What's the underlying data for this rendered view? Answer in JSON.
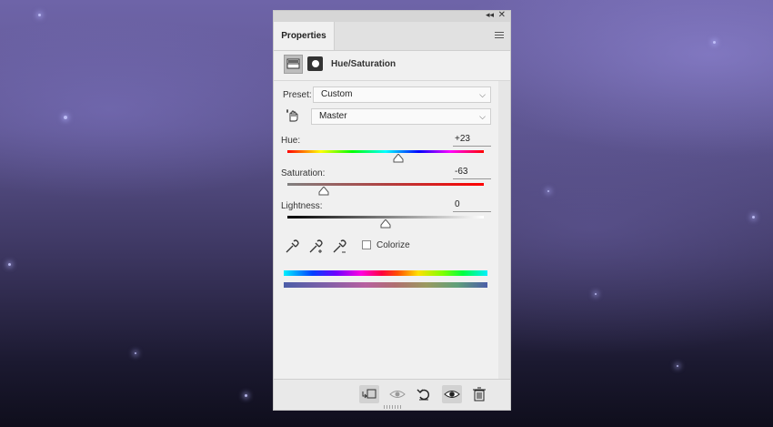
{
  "panel": {
    "tab_label": "Properties",
    "collapse_icon": "double-chevron-icon",
    "close_icon": "close-icon",
    "menu_icon": "panel-menu-icon",
    "adjustment_title": "Hue/Saturation"
  },
  "controls": {
    "preset_label": "Preset:",
    "preset_value": "Custom",
    "channel_value": "Master",
    "hue_label": "Hue:",
    "hue_value": "+23",
    "saturation_label": "Saturation:",
    "saturation_value": "-63",
    "lightness_label": "Lightness:",
    "lightness_value": "0",
    "colorize_label": "Colorize",
    "colorize_checked": false
  },
  "sliders": {
    "hue": {
      "value": 23,
      "min": -180,
      "max": 180
    },
    "saturation": {
      "value": -63,
      "min": -100,
      "max": 100
    },
    "lightness": {
      "value": 0,
      "min": -100,
      "max": 100
    }
  },
  "footer_icons": [
    "clip-to-layer-icon",
    "view-previous-icon",
    "reset-icon",
    "visibility-eye-icon",
    "trash-icon"
  ]
}
